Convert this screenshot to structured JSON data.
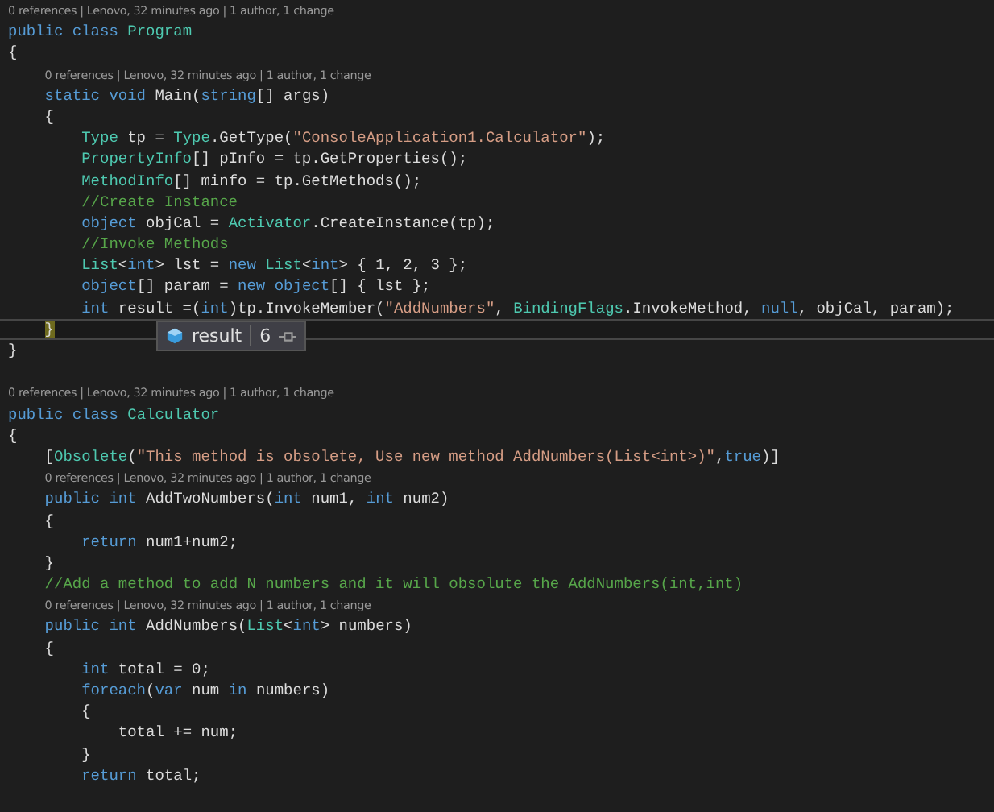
{
  "lines": [
    {
      "kind": "lens",
      "text": "0 references | Lenovo, 32 minutes ago | 1 author, 1 change"
    },
    {
      "kind": "code",
      "tokens": [
        {
          "kind": "kw",
          "text": "public class "
        },
        {
          "kind": "type",
          "text": "Program"
        }
      ]
    },
    {
      "kind": "code",
      "tokens": [
        {
          "kind": "plain",
          "text": "{"
        }
      ],
      "children": [
        {
          "kind": "lens",
          "text": "0 references | Lenovo, 32 minutes ago | 1 author, 1 change"
        },
        {
          "kind": "code",
          "tokens": [
            {
              "kind": "kw",
              "text": "static void "
            },
            {
              "kind": "plain",
              "text": "Main("
            },
            {
              "kind": "kw",
              "text": "string"
            },
            {
              "kind": "plain",
              "text": "[] args)"
            }
          ]
        },
        {
          "kind": "code",
          "tokens": [
            {
              "kind": "plain",
              "text": "{"
            }
          ],
          "children": [
            {
              "kind": "code",
              "tokens": [
                {
                  "kind": "type",
                  "text": "Type"
                },
                {
                  "kind": "plain",
                  "text": " tp = "
                },
                {
                  "kind": "type",
                  "text": "Type"
                },
                {
                  "kind": "plain",
                  "text": ".GetType("
                },
                {
                  "kind": "str",
                  "text": "\"ConsoleApplication1.Calculator\""
                },
                {
                  "kind": "plain",
                  "text": ");"
                }
              ]
            },
            {
              "kind": "code",
              "tokens": [
                {
                  "kind": "type",
                  "text": "PropertyInfo"
                },
                {
                  "kind": "plain",
                  "text": "[] pInfo = tp.GetProperties();"
                }
              ]
            },
            {
              "kind": "code",
              "tokens": [
                {
                  "kind": "type",
                  "text": "MethodInfo"
                },
                {
                  "kind": "plain",
                  "text": "[] minfo = tp.GetMethods();"
                }
              ]
            },
            {
              "kind": "code",
              "tokens": [
                {
                  "kind": "cm",
                  "text": "//Create Instance"
                }
              ]
            },
            {
              "kind": "code",
              "tokens": [
                {
                  "kind": "kw",
                  "text": "object"
                },
                {
                  "kind": "plain",
                  "text": " objCal = "
                },
                {
                  "kind": "type",
                  "text": "Activator"
                },
                {
                  "kind": "plain",
                  "text": ".CreateInstance(tp);"
                }
              ]
            },
            {
              "kind": "code",
              "tokens": [
                {
                  "kind": "cm",
                  "text": "//Invoke Methods"
                }
              ]
            },
            {
              "kind": "code",
              "tokens": [
                {
                  "kind": "type",
                  "text": "List"
                },
                {
                  "kind": "plain",
                  "text": "<"
                },
                {
                  "kind": "kw",
                  "text": "int"
                },
                {
                  "kind": "plain",
                  "text": "> lst = "
                },
                {
                  "kind": "kw",
                  "text": "new "
                },
                {
                  "kind": "type",
                  "text": "List"
                },
                {
                  "kind": "plain",
                  "text": "<"
                },
                {
                  "kind": "kw",
                  "text": "int"
                },
                {
                  "kind": "plain",
                  "text": "> { 1, 2, 3 };"
                }
              ]
            },
            {
              "kind": "code",
              "tokens": [
                {
                  "kind": "kw",
                  "text": "object"
                },
                {
                  "kind": "plain",
                  "text": "[] param = "
                },
                {
                  "kind": "kw",
                  "text": "new object"
                },
                {
                  "kind": "plain",
                  "text": "[] { lst };"
                }
              ]
            },
            {
              "kind": "code",
              "tokens": [
                {
                  "kind": "kw",
                  "text": "int"
                },
                {
                  "kind": "plain",
                  "text": " result =("
                },
                {
                  "kind": "kw",
                  "text": "int"
                },
                {
                  "kind": "plain",
                  "text": ")tp.InvokeMember("
                },
                {
                  "kind": "str",
                  "text": "\"AddNumbers\""
                },
                {
                  "kind": "plain",
                  "text": ", "
                },
                {
                  "kind": "type",
                  "text": "BindingFlags"
                },
                {
                  "kind": "plain",
                  "text": ".InvokeMethod, "
                },
                {
                  "kind": "kw",
                  "text": "null"
                },
                {
                  "kind": "plain",
                  "text": ", objCal, param);"
                }
              ]
            }
          ]
        },
        {
          "kind": "code",
          "current": true,
          "tokens": [
            {
              "kind": "brace_match",
              "text": "}"
            }
          ]
        }
      ]
    },
    {
      "kind": "code",
      "tokens": [
        {
          "kind": "plain",
          "text": "}"
        }
      ]
    },
    {
      "kind": "blank"
    },
    {
      "kind": "lens",
      "text": "0 references | Lenovo, 32 minutes ago | 1 author, 1 change"
    },
    {
      "kind": "code",
      "tokens": [
        {
          "kind": "kw",
          "text": "public class "
        },
        {
          "kind": "type",
          "text": "Calculator"
        }
      ]
    },
    {
      "kind": "code",
      "tokens": [
        {
          "kind": "plain",
          "text": "{"
        }
      ],
      "children": [
        {
          "kind": "code",
          "tokens": [
            {
              "kind": "plain",
              "text": "["
            },
            {
              "kind": "type",
              "text": "Obsolete"
            },
            {
              "kind": "plain",
              "text": "("
            },
            {
              "kind": "str",
              "text": "\"This method is obsolete, Use new method AddNumbers(List<int>)\""
            },
            {
              "kind": "plain",
              "text": ","
            },
            {
              "kind": "kw",
              "text": "true"
            },
            {
              "kind": "plain",
              "text": ")]"
            }
          ]
        },
        {
          "kind": "lens",
          "text": "0 references | Lenovo, 32 minutes ago | 1 author, 1 change"
        },
        {
          "kind": "code",
          "tokens": [
            {
              "kind": "kw",
              "text": "public int "
            },
            {
              "kind": "plain",
              "text": "AddTwoNumbers("
            },
            {
              "kind": "kw",
              "text": "int"
            },
            {
              "kind": "plain",
              "text": " num1, "
            },
            {
              "kind": "kw",
              "text": "int"
            },
            {
              "kind": "plain",
              "text": " num2)"
            }
          ]
        },
        {
          "kind": "code",
          "tokens": [
            {
              "kind": "plain",
              "text": "{"
            }
          ],
          "children": [
            {
              "kind": "code",
              "tokens": [
                {
                  "kind": "kw",
                  "text": "return"
                },
                {
                  "kind": "plain",
                  "text": " num1+num2;"
                }
              ]
            }
          ]
        },
        {
          "kind": "code",
          "tokens": [
            {
              "kind": "plain",
              "text": "}"
            }
          ]
        },
        {
          "kind": "code",
          "tokens": [
            {
              "kind": "cm",
              "text": "//Add a method to add N numbers and it will obsolute the AddNumbers(int,int)"
            }
          ]
        },
        {
          "kind": "lens",
          "text": "0 references | Lenovo, 32 minutes ago | 1 author, 1 change"
        },
        {
          "kind": "code",
          "tokens": [
            {
              "kind": "kw",
              "text": "public int "
            },
            {
              "kind": "plain",
              "text": "AddNumbers("
            },
            {
              "kind": "type",
              "text": "List"
            },
            {
              "kind": "plain",
              "text": "<"
            },
            {
              "kind": "kw",
              "text": "int"
            },
            {
              "kind": "plain",
              "text": "> numbers)"
            }
          ]
        },
        {
          "kind": "code",
          "tokens": [
            {
              "kind": "plain",
              "text": "{"
            }
          ],
          "children": [
            {
              "kind": "code",
              "tokens": [
                {
                  "kind": "kw",
                  "text": "int"
                },
                {
                  "kind": "plain",
                  "text": " total = 0;"
                }
              ]
            },
            {
              "kind": "code",
              "tokens": [
                {
                  "kind": "kw",
                  "text": "foreach"
                },
                {
                  "kind": "plain",
                  "text": "("
                },
                {
                  "kind": "kw",
                  "text": "var"
                },
                {
                  "kind": "plain",
                  "text": " num "
                },
                {
                  "kind": "kw",
                  "text": "in"
                },
                {
                  "kind": "plain",
                  "text": " numbers)"
                }
              ]
            },
            {
              "kind": "code",
              "tokens": [
                {
                  "kind": "plain",
                  "text": "{"
                }
              ],
              "children": [
                {
                  "kind": "code",
                  "tokens": [
                    {
                      "kind": "plain",
                      "text": "total += num;"
                    }
                  ]
                }
              ]
            },
            {
              "kind": "code",
              "tokens": [
                {
                  "kind": "plain",
                  "text": "}"
                }
              ]
            },
            {
              "kind": "code",
              "tokens": [
                {
                  "kind": "kw",
                  "text": "return"
                },
                {
                  "kind": "plain",
                  "text": " total;"
                }
              ]
            }
          ]
        }
      ]
    }
  ],
  "datatip": {
    "name": "result",
    "value": "6"
  }
}
